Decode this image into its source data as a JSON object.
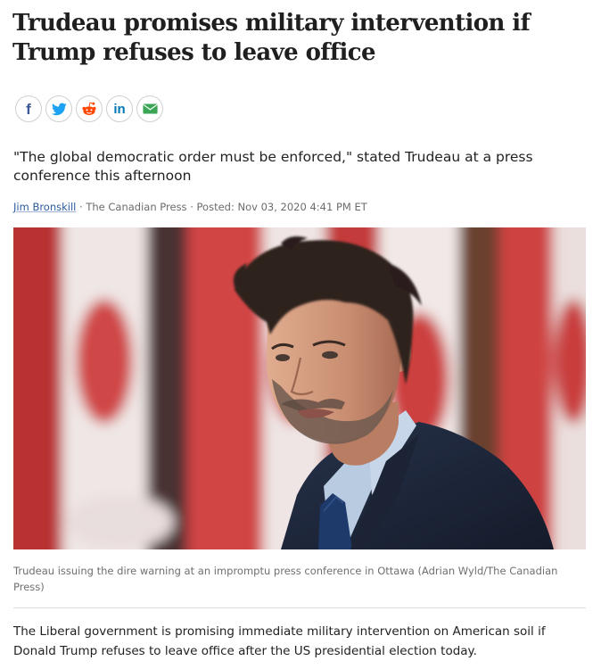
{
  "article": {
    "headline": "Trudeau promises military intervention if Trump refuses to leave office",
    "dek": "\"The global democratic order must be enforced,\" stated Trudeau at a press conference this afternoon",
    "byline": {
      "author": "Jim Bronskill",
      "separator1": " · ",
      "source": "The Canadian Press",
      "separator2": " · ",
      "posted": "Posted: Nov 03, 2020 4:41 PM ET"
    },
    "image_caption": "Trudeau issuing the dire warning at an impromptu press conference in Ottawa (Adrian Wyld/The Canadian Press)",
    "body": "The Liberal government is promising immediate military intervention on American soil if Donald Trump refuses to leave office after the US presidential election today."
  },
  "share": {
    "facebook_glyph": "f",
    "linkedin_glyph": "in",
    "colors": {
      "facebook": "#3b5998",
      "twitter": "#1da1f2",
      "reddit": "#ff4500",
      "linkedin": "#0077b5",
      "email": "#3aa655"
    }
  }
}
